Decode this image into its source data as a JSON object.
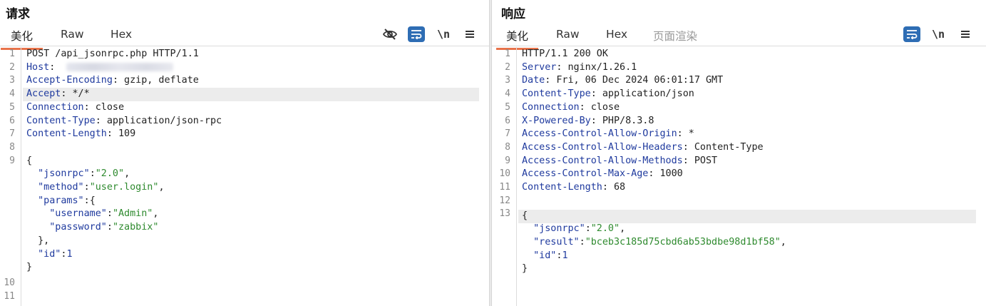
{
  "request": {
    "title": "请求",
    "tabs": [
      {
        "label": "美化",
        "active": true
      },
      {
        "label": "Raw"
      },
      {
        "label": "Hex"
      }
    ],
    "toolbar": {
      "newline_label": "\\n",
      "icons": [
        "eye-off-icon",
        "word-wrap-icon",
        "newline-icon",
        "menu-icon"
      ]
    },
    "line_numbers": [
      "1",
      "2",
      "3",
      "4",
      "5",
      "6",
      "7",
      "8",
      "9",
      "10",
      "11"
    ],
    "lines": [
      {
        "raw": "POST /api_jsonrpc.php HTTP/1.1"
      },
      {
        "name": "Host",
        "value": "",
        "blurred": true
      },
      {
        "name": "Accept-Encoding",
        "value": " gzip, deflate"
      },
      {
        "name": "Accept",
        "value": " */*",
        "highlight": true
      },
      {
        "name": "Connection",
        "value": " close"
      },
      {
        "name": "Content-Type",
        "value": " application/json-rpc"
      },
      {
        "name": "Content-Length",
        "value": " 109"
      }
    ],
    "body": {
      "open": "{",
      "fields": [
        {
          "key": "\"jsonrpc\"",
          "value": "\"2.0\"",
          "type": "str",
          "suffix": ","
        },
        {
          "key": "\"method\"",
          "value": "\"user.login\"",
          "type": "str",
          "suffix": ","
        },
        {
          "key": "\"params\"",
          "value": "{",
          "type": "open"
        },
        {
          "key": "\"username\"",
          "value": "\"Admin\"",
          "type": "str",
          "suffix": ",",
          "indent": 2
        },
        {
          "key": "\"password\"",
          "value": "\"zabbix\"",
          "type": "str",
          "indent": 2
        },
        {
          "close": "},"
        },
        {
          "key": "\"id\"",
          "value": "1",
          "type": "num"
        }
      ],
      "close": "}"
    }
  },
  "response": {
    "title": "响应",
    "tabs": [
      {
        "label": "美化",
        "active": true
      },
      {
        "label": "Raw"
      },
      {
        "label": "Hex"
      },
      {
        "label": "页面渲染",
        "disabled": true
      }
    ],
    "toolbar": {
      "newline_label": "\\n",
      "icons": [
        "word-wrap-icon",
        "newline-icon",
        "menu-icon"
      ]
    },
    "line_numbers": [
      "1",
      "2",
      "3",
      "4",
      "5",
      "6",
      "7",
      "8",
      "9",
      "10",
      "11",
      "12",
      "13"
    ],
    "lines": [
      {
        "raw": "HTTP/1.1 200 OK"
      },
      {
        "name": "Server",
        "value": " nginx/1.26.1"
      },
      {
        "name": "Date",
        "value": " Fri, 06 Dec 2024 06:01:17 GMT"
      },
      {
        "name": "Content-Type",
        "value": " application/json"
      },
      {
        "name": "Connection",
        "value": " close"
      },
      {
        "name": "X-Powered-By",
        "value": " PHP/8.3.8"
      },
      {
        "name": "Access-Control-Allow-Origin",
        "value": " *"
      },
      {
        "name": "Access-Control-Allow-Headers",
        "value": " Content-Type"
      },
      {
        "name": "Access-Control-Allow-Methods",
        "value": " POST"
      },
      {
        "name": "Access-Control-Max-Age",
        "value": " 1000"
      },
      {
        "name": "Content-Length",
        "value": " 68"
      }
    ],
    "body": {
      "open": "{",
      "fields": [
        {
          "key": "\"jsonrpc\"",
          "value": "\"2.0\"",
          "type": "str",
          "suffix": ","
        },
        {
          "key": "\"result\"",
          "value": "\"bceb3c185d75cbd6ab53bdbe98d1bf58\"",
          "type": "str",
          "suffix": ","
        },
        {
          "key": "\"id\"",
          "value": "1",
          "type": "num"
        }
      ],
      "close": "}"
    }
  },
  "colors": {
    "accent_tab": "#e8734a",
    "header_name": "#1f3a9e",
    "json_string": "#2e8a2e",
    "toggle_on": "#2e6db4"
  }
}
